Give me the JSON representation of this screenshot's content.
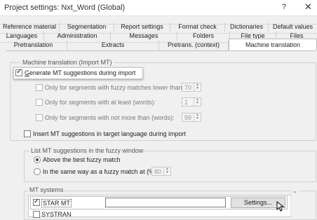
{
  "window": {
    "title": "Project settings: Nxt_Word (Global)",
    "help": "?",
    "close": "✕"
  },
  "tabs": {
    "row1": [
      "Reference material",
      "Segmentation",
      "Report settings",
      "Format check",
      "Dictionaries",
      "Default values"
    ],
    "row2": [
      "Languages",
      "Administration",
      "Messages",
      "Folders",
      "File type",
      "Files"
    ],
    "row3": [
      "Pretranslation",
      "Extracts",
      "Pretrans. (context)",
      "Machine translation"
    ],
    "active": "Machine translation"
  },
  "import_group": {
    "label": "Machine translation (Import MT)",
    "generate": "Generate MT suggestions during import",
    "fuzzy_lower": "Only for segments with fuzzy matches lower than (%):",
    "fuzzy_lower_value": "70",
    "at_least": "Only for segments with at least (words):",
    "at_least_value": "1",
    "not_more": "Only for segments with not more than (words):",
    "not_more_value": "99",
    "insert_target": "Insert MT suggestions in target language during import"
  },
  "fuzzy_window": {
    "label": "List MT suggestions in the fuzzy window",
    "above": "Above the best fuzzy match",
    "same_way": "In the same way as a fuzzy match at (%):",
    "same_way_value": "80"
  },
  "mt_systems": {
    "label": "MT systems",
    "items": [
      {
        "name": "STAR MT",
        "checked": true,
        "settings": "Settings..."
      },
      {
        "name": "SYSTRAN",
        "checked": false
      }
    ]
  }
}
